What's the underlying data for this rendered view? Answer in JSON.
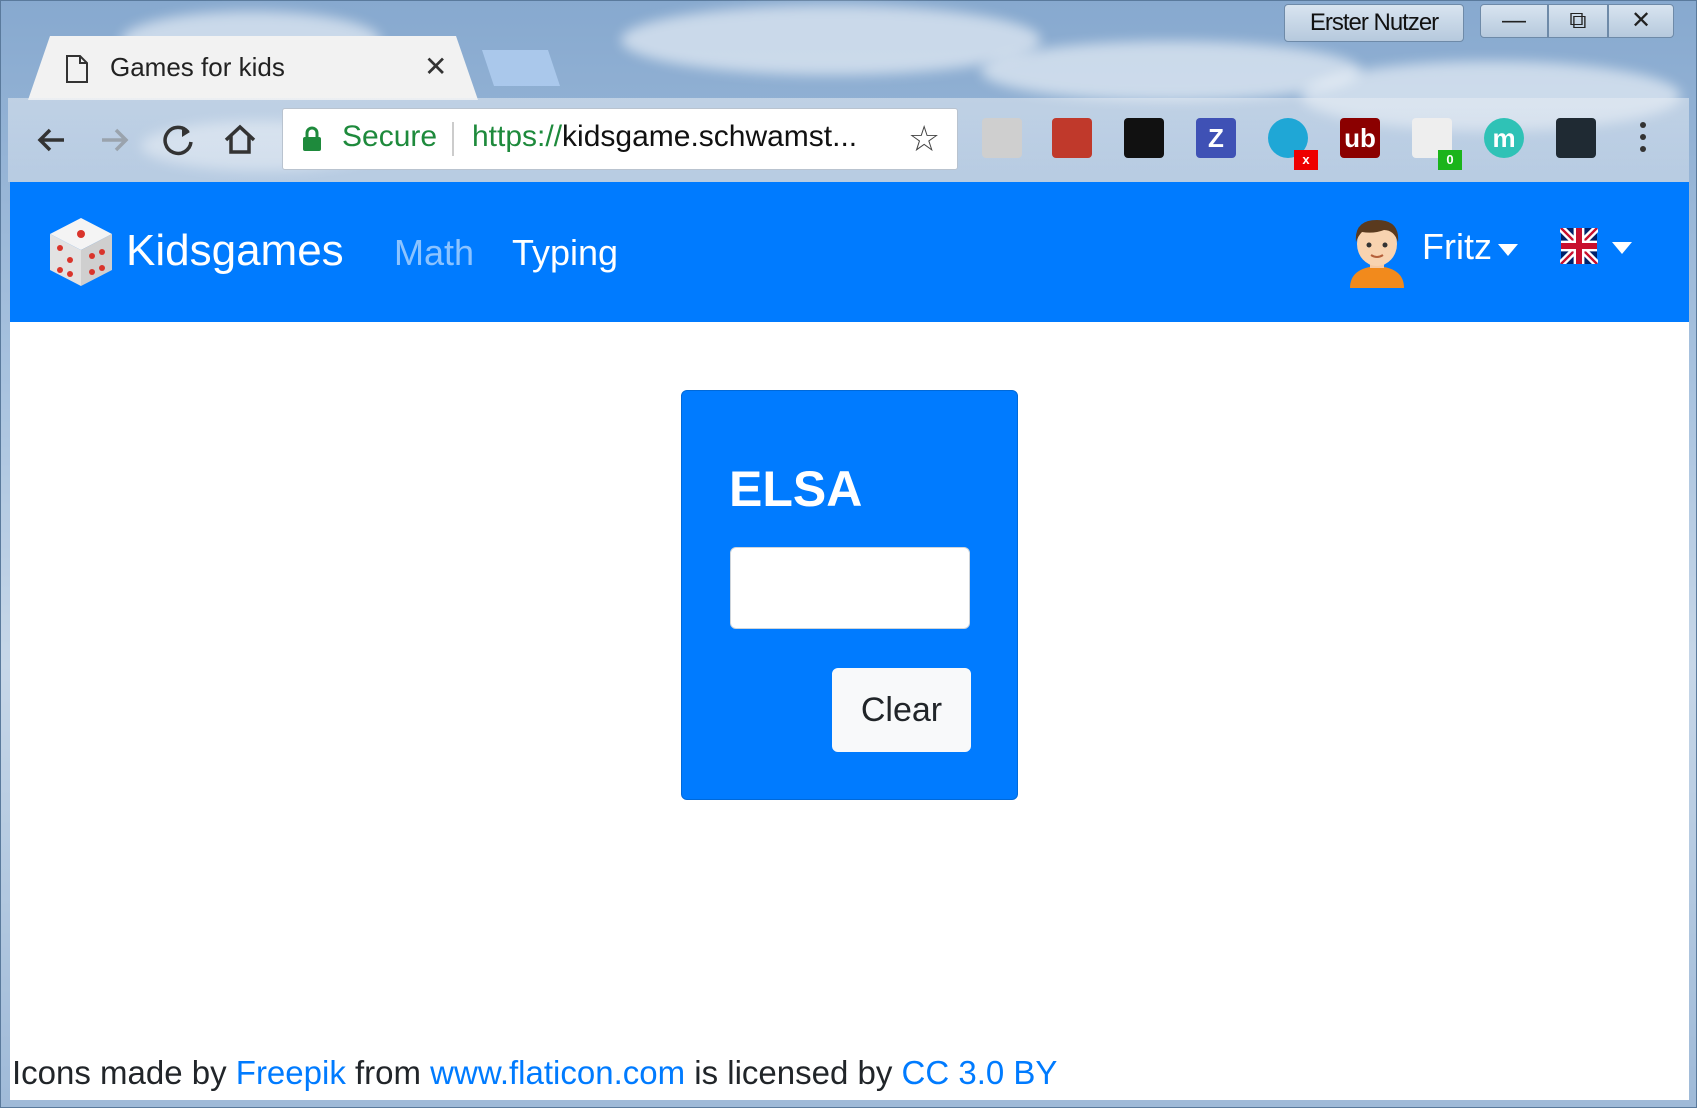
{
  "window": {
    "user_badge": "Erster Nutzer",
    "minimize_glyph": "—",
    "maximize_glyph": "⧉",
    "close_glyph": "✕"
  },
  "tab": {
    "title": "Games for kids",
    "close_glyph": "✕"
  },
  "omnibox": {
    "security_label": "Secure",
    "url_scheme": "https://",
    "url_rest": "kidsgame.schwamst...",
    "star_glyph": "☆"
  },
  "extensions": [
    {
      "name": "dropbox-icon",
      "color": "#cfcfcf"
    },
    {
      "name": "lastpass-icon",
      "color": "#c0392b"
    },
    {
      "name": "colorful-ext-icon",
      "color": "#111111"
    },
    {
      "name": "zotero-icon",
      "color": "#3f51b5",
      "label": "Z"
    },
    {
      "name": "sync-ext-icon",
      "color": "#1fa7d6",
      "badge": "x"
    },
    {
      "name": "ublock-icon",
      "color": "#8b0000",
      "label": "ub"
    },
    {
      "name": "privacy-badger-icon",
      "color": "#eeeeee",
      "badge": "0"
    },
    {
      "name": "mercury-icon",
      "color": "#2fc2b6",
      "label": "m"
    },
    {
      "name": "react-devtools-icon",
      "color": "#1f2a33"
    }
  ],
  "navbar": {
    "brand": "Kidsgames",
    "links": [
      "Math",
      "Typing"
    ],
    "user": "Fritz",
    "colors": {
      "primary": "#007bff",
      "muted_link": "rgba(255,255,255,0.55)"
    }
  },
  "card": {
    "title": "ELSA",
    "input_value": "",
    "clear_label": "Clear"
  },
  "footer": {
    "prefix": "Icons made by ",
    "author": "Freepik",
    "mid1": " from ",
    "site": "www.flaticon.com",
    "mid2": " is licensed by ",
    "license": "CC 3.0 BY"
  }
}
